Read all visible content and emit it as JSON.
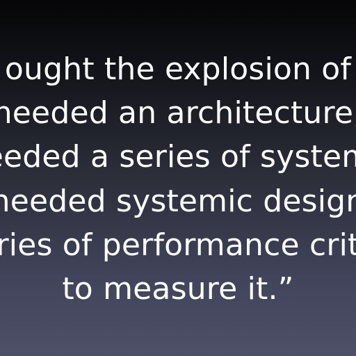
{
  "slide": {
    "lines": [
      "ought the explosion of",
      "needed an architecture,",
      "eeded a series of system",
      "needed systemic design",
      "ries of performance crit",
      "to measure it.”"
    ]
  }
}
